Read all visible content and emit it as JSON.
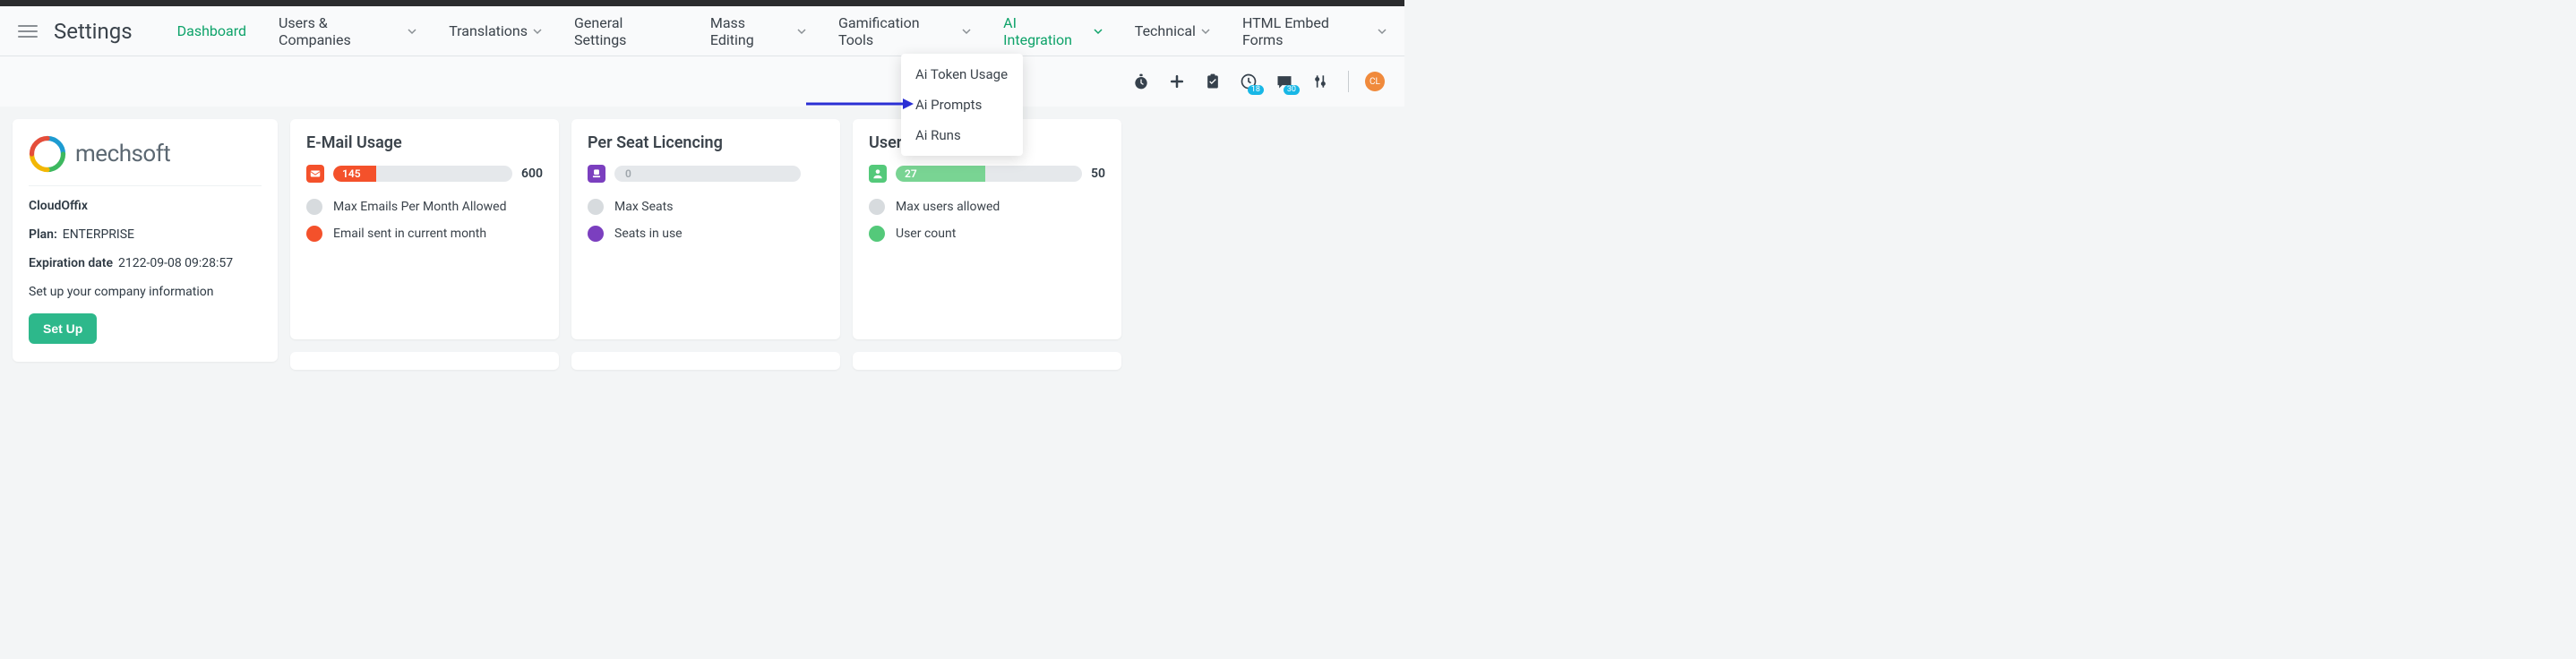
{
  "header": {
    "title": "Settings",
    "nav": [
      {
        "label": "Dashboard",
        "has_chevron": false,
        "active": true
      },
      {
        "label": "Users & Companies",
        "has_chevron": true
      },
      {
        "label": "Translations",
        "has_chevron": true
      },
      {
        "label": "General Settings",
        "has_chevron": false
      },
      {
        "label": "Mass Editing",
        "has_chevron": true
      },
      {
        "label": "Gamification Tools",
        "has_chevron": true
      },
      {
        "label": "AI Integration",
        "has_chevron": true,
        "highlight": true
      },
      {
        "label": "Technical",
        "has_chevron": true
      },
      {
        "label": "HTML Embed Forms",
        "has_chevron": true
      }
    ]
  },
  "dropdown": {
    "items": [
      "Ai Token Usage",
      "Ai Prompts",
      "Ai Runs"
    ]
  },
  "right_icons": {
    "badge_activities": "18",
    "badge_messages": "30",
    "avatar_initials": "CL"
  },
  "sidebar": {
    "logo_text": "mechsoft",
    "company": "CloudOffix",
    "plan_label": "Plan:",
    "plan_value": "ENTERPRISE",
    "expiration_label": "Expiration date",
    "expiration_value": "2122-09-08 09:28:57",
    "setup_hint": "Set up your company information",
    "setup_btn": "Set Up"
  },
  "panels": {
    "email": {
      "title": "E-Mail Usage",
      "value": "145",
      "total": "600",
      "fill_percent": 24,
      "fill_color": "#f4512b",
      "icon_color": "#f4512b",
      "legend": [
        {
          "color": "dot-gray",
          "label": "Max Emails Per Month Allowed"
        },
        {
          "color": "dot-orange",
          "label": "Email sent in current month"
        }
      ]
    },
    "seat": {
      "title": "Per Seat Licencing",
      "value": "0",
      "total": "",
      "fill_percent": 3,
      "fill_color": "#d7dbde",
      "icon_color": "#7b3fbf",
      "legend": [
        {
          "color": "dot-gray",
          "label": "Max Seats"
        },
        {
          "color": "dot-purple",
          "label": "Seats in use"
        }
      ]
    },
    "users": {
      "title": "Users",
      "value": "27",
      "total": "50",
      "fill_percent": 48,
      "fill_color": "#79d493",
      "icon_color": "#54c97a",
      "legend": [
        {
          "color": "dot-gray",
          "label": "Max users allowed"
        },
        {
          "color": "dot-green",
          "label": "User count"
        }
      ]
    }
  }
}
